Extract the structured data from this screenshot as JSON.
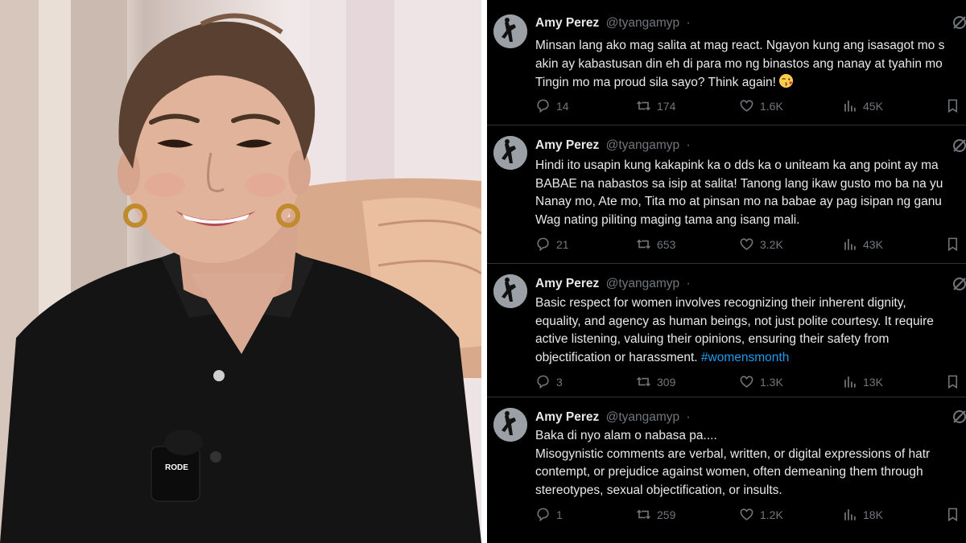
{
  "tweets": [
    {
      "name": "Amy Perez",
      "handle": "@tyangamyp",
      "separator": "·",
      "lines": [
        "Minsan lang ako mag salita at mag react. Ngayon kung ang isasagot mo s",
        "akin ay kabastusan din eh di para mo ng binastos ang nanay at tyahin mo",
        "Tingin mo ma proud sila sayo? Think again!"
      ],
      "emoji": "kissing-face-emoji",
      "replies": "14",
      "reposts": "174",
      "likes": "1.6K",
      "views": "45K"
    },
    {
      "name": "Amy Perez",
      "handle": "@tyangamyp",
      "separator": "·",
      "lines": [
        "Hindi ito usapin kung kakapink ka o dds ka o uniteam ka ang point ay ma",
        "BABAE na nabastos sa isip at salita! Tanong lang ikaw gusto mo ba na yu",
        "Nanay mo, Ate mo, Tita mo at pinsan mo na babae ay pag isipan ng ganu",
        "Wag nating piliting maging tama ang isang mali."
      ],
      "replies": "21",
      "reposts": "653",
      "likes": "3.2K",
      "views": "43K"
    },
    {
      "name": "Amy Perez",
      "handle": "@tyangamyp",
      "separator": "·",
      "lines": [
        "Basic respect for women involves recognizing their inherent dignity,",
        "equality, and agency as human beings, not just polite courtesy. It require",
        "active listening, valuing their opinions, ensuring their safety from",
        "objectification or harassment."
      ],
      "hashtag": "#womensmonth",
      "replies": "3",
      "reposts": "309",
      "likes": "1.3K",
      "views": "13K"
    },
    {
      "name": "Amy Perez",
      "handle": "@tyangamyp",
      "separator": "·",
      "lines": [
        "Baka di nyo alam o nabasa pa....",
        "Misogynistic comments are verbal, written, or digital expressions of hatr",
        "contempt, or prejudice against women, often demeaning them through",
        "stereotypes, sexual objectification, or insults."
      ],
      "replies": "1",
      "reposts": "259",
      "likes": "1.2K",
      "views": "18K"
    }
  ],
  "photo": {
    "mic_brand": "RODE"
  },
  "colors": {
    "background": "#000000",
    "text": "#e7e9ea",
    "muted": "#71767b",
    "link": "#1d9bf0",
    "divider": "#2f3336"
  }
}
